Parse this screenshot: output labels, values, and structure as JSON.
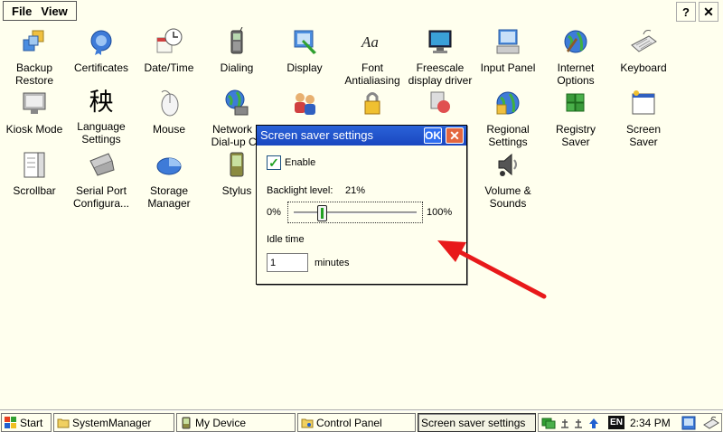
{
  "menu": {
    "file": "File",
    "view": "View",
    "help_glyph": "?",
    "close_glyph": "✕"
  },
  "icons": [
    {
      "key": "backup-restore",
      "label": "Backup\nRestore",
      "icon": "backup-restore-icon"
    },
    {
      "key": "certificates",
      "label": "Certificates",
      "icon": "certificates-icon"
    },
    {
      "key": "date-time",
      "label": "Date/Time",
      "icon": "date-time-icon"
    },
    {
      "key": "dialing",
      "label": "Dialing",
      "icon": "dialing-icon"
    },
    {
      "key": "display",
      "label": "Display",
      "icon": "display-icon"
    },
    {
      "key": "font-antialiasing",
      "label": "Font\nAntialiasing",
      "icon": "font-antialiasing-icon"
    },
    {
      "key": "freescale-display-driver",
      "label": "Freescale\ndisplay driver",
      "icon": "freescale-display-driver-icon"
    },
    {
      "key": "input-panel",
      "label": "Input Panel",
      "icon": "input-panel-icon"
    },
    {
      "key": "internet-options",
      "label": "Internet\nOptions",
      "icon": "internet-options-icon"
    },
    {
      "key": "keyboard",
      "label": "Keyboard",
      "icon": "keyboard-icon"
    },
    {
      "key": "kiosk-mode",
      "label": "Kiosk Mode",
      "icon": "kiosk-mode-icon"
    },
    {
      "key": "language-settings",
      "label": "Language\nSettings",
      "icon": "language-settings-icon",
      "glyph": "秧"
    },
    {
      "key": "mouse",
      "label": "Mouse",
      "icon": "mouse-icon"
    },
    {
      "key": "network-dialup",
      "label": "Network a\nDial-up Co",
      "icon": "network-dialup-icon"
    },
    {
      "key": "regional-settings",
      "label": "Regional\nSettings",
      "icon": "regional-settings-icon"
    },
    {
      "key": "registry-saver",
      "label": "Registry\nSaver",
      "icon": "registry-saver-icon"
    },
    {
      "key": "screen-saver",
      "label": "Screen\nSaver",
      "icon": "screen-saver-icon"
    },
    {
      "key": "scrollbar",
      "label": "Scrollbar",
      "icon": "scrollbar-icon"
    },
    {
      "key": "serial-port",
      "label": "Serial Port\nConfigura...",
      "icon": "serial-port-icon"
    },
    {
      "key": "storage-manager",
      "label": "Storage\nManager",
      "icon": "storage-manager-icon"
    },
    {
      "key": "stylus",
      "label": "Stylus",
      "icon": "stylus-icon"
    },
    {
      "key": "volume-sounds",
      "label": "Volume &\nSounds",
      "icon": "volume-sounds-icon"
    }
  ],
  "dialog": {
    "title": "Screen saver settings",
    "ok_label": "OK",
    "close_glyph": "✕",
    "enable_label": "Enable",
    "enable_checked": true,
    "backlight_label": "Backlight level:",
    "backlight_value": "21%",
    "backlight_fraction": 0.21,
    "min_label": "0%",
    "max_label": "100%",
    "idle_label": "Idle time",
    "idle_value": "1",
    "minutes_label": "minutes"
  },
  "taskbar": {
    "start": "Start",
    "buttons": [
      {
        "label": "SystemManager"
      },
      {
        "label": "My Device"
      },
      {
        "label": "Control Panel"
      },
      {
        "label": "Screen saver settings"
      }
    ],
    "lang": "EN",
    "time": "2:34 PM"
  },
  "colors": {
    "desktop_bg": "#FFFFEE",
    "titlebar": "#1a47c0",
    "arrow": "#E8191A"
  }
}
